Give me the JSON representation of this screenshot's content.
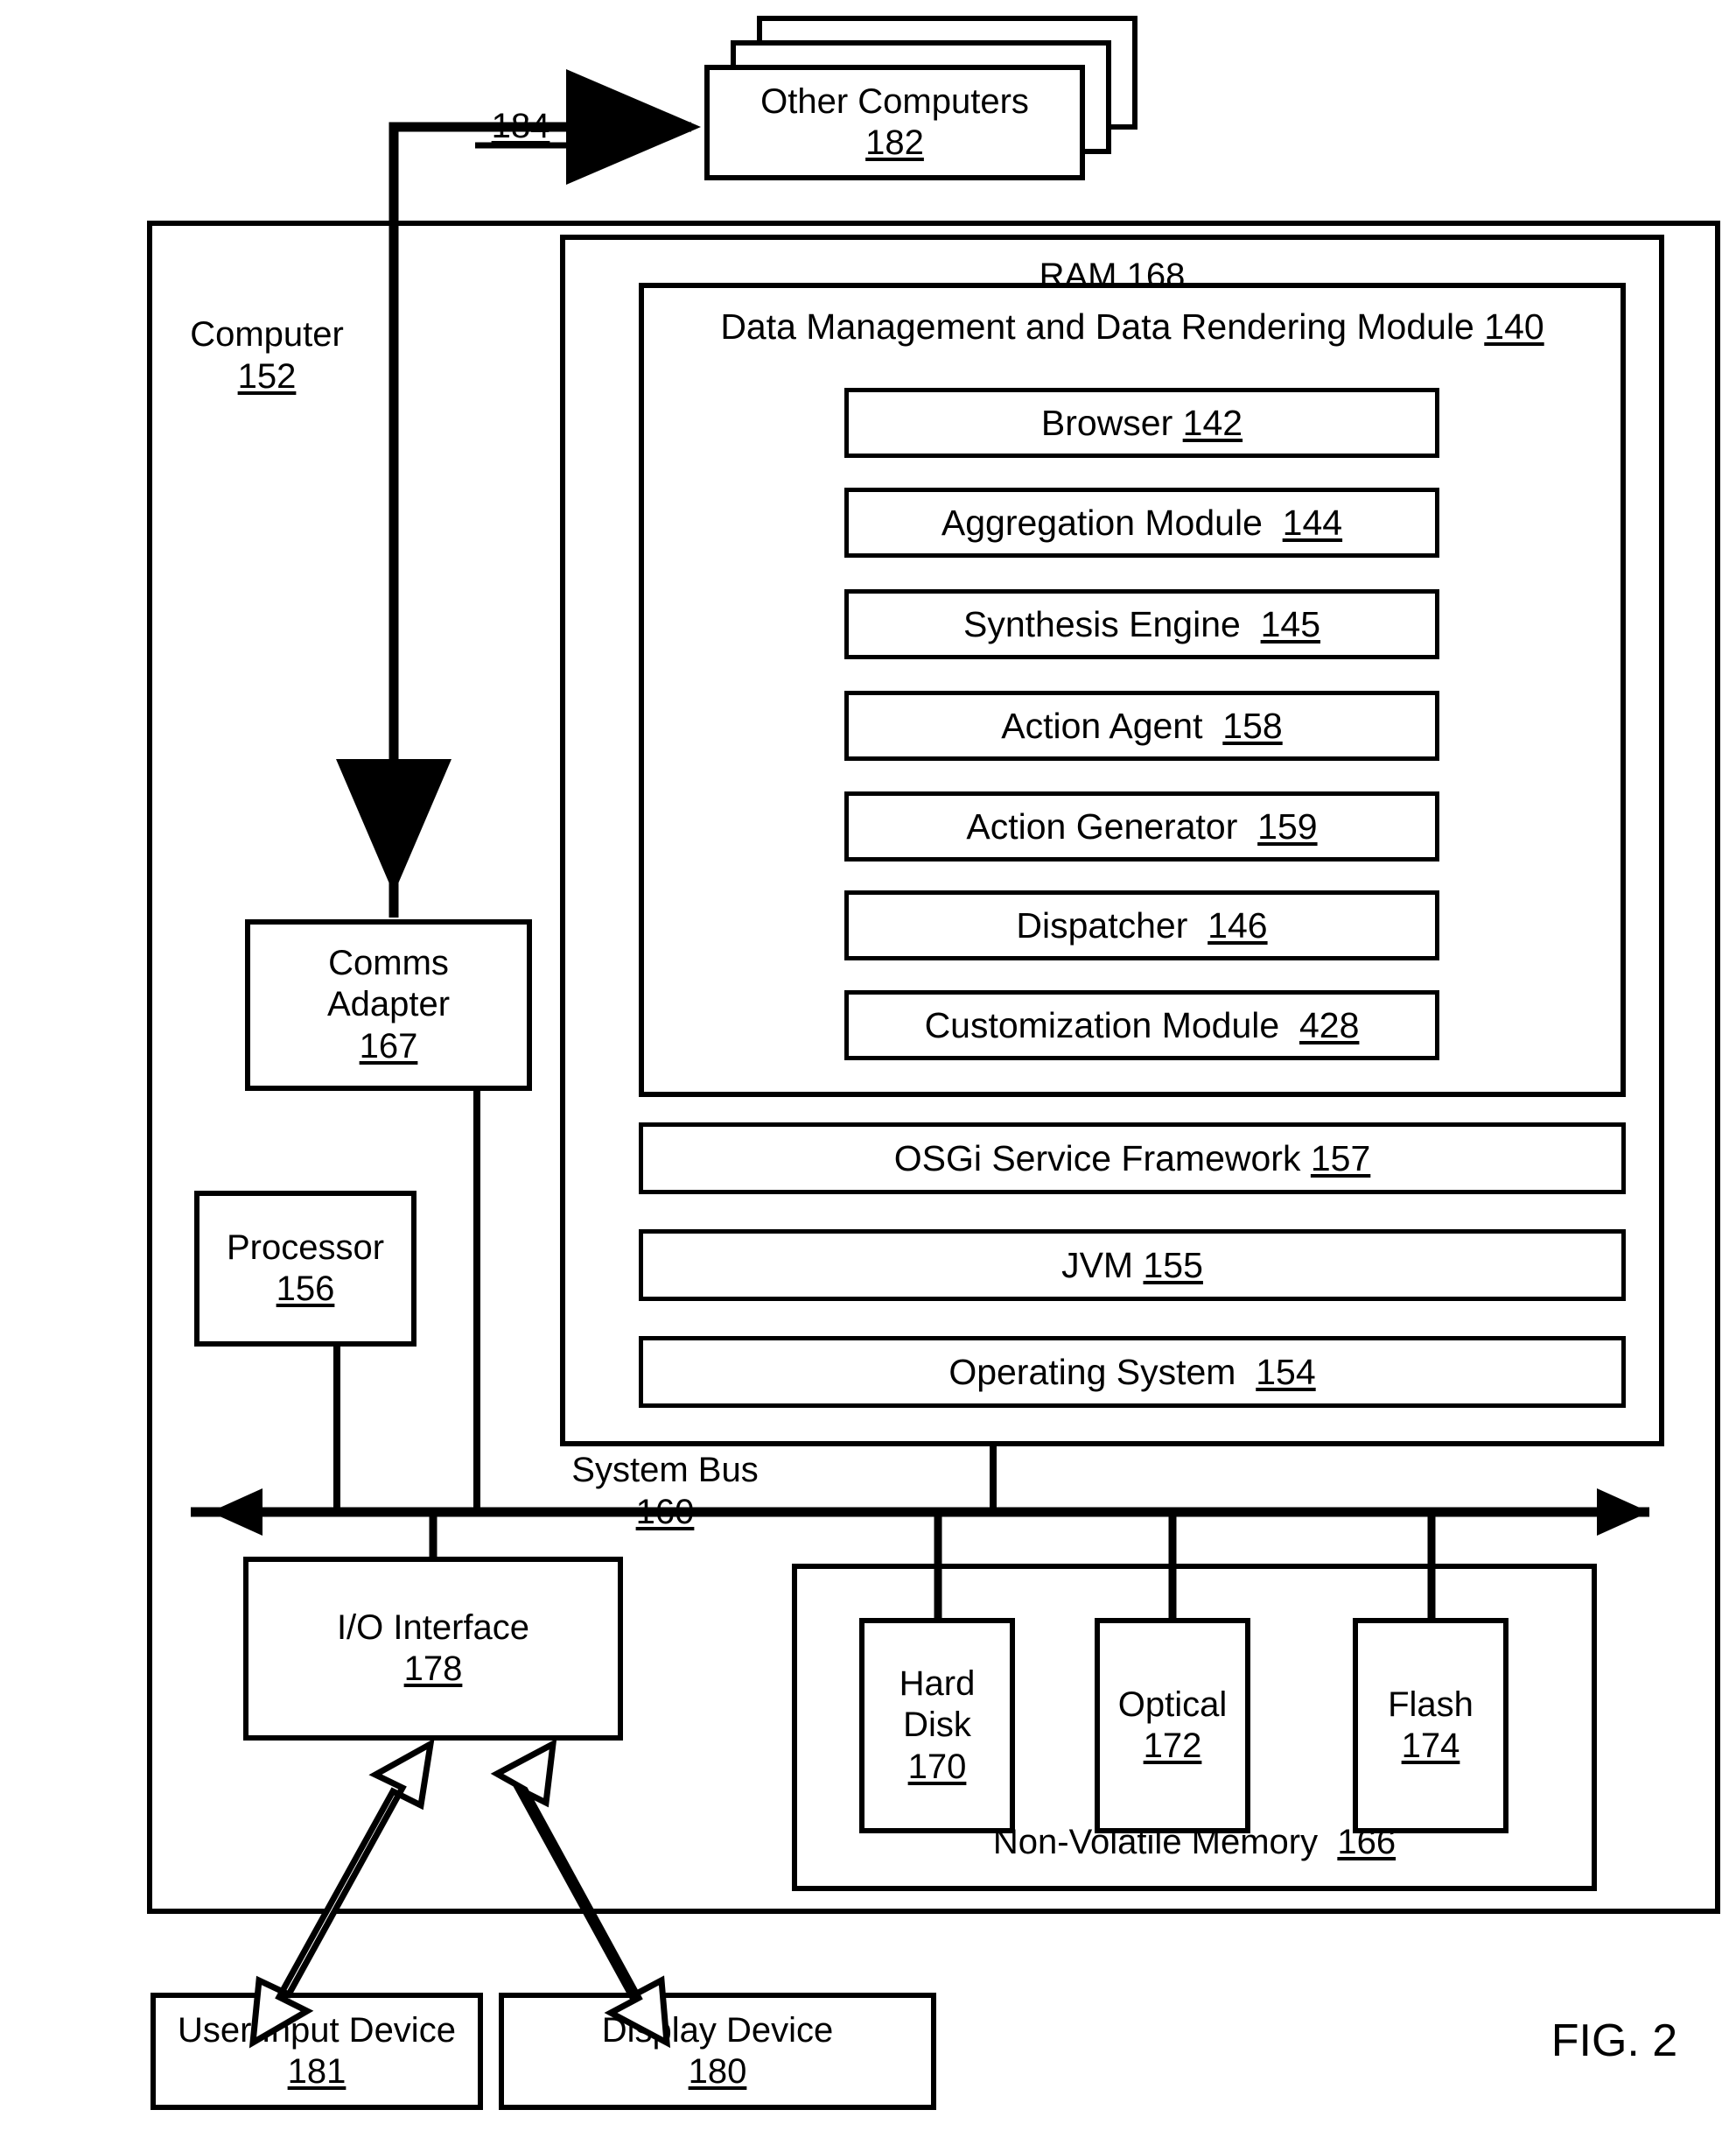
{
  "figure": {
    "caption": "FIG. 2"
  },
  "other_computers": {
    "label": "Other Computers",
    "number": "182",
    "stack_count": 3
  },
  "network_link": {
    "number": "184"
  },
  "computer": {
    "label": "Computer",
    "number": "152"
  },
  "comms_adapter": {
    "line1": "Comms",
    "line2": "Adapter",
    "number": "167"
  },
  "processor": {
    "label": "Processor",
    "number": "156"
  },
  "ram": {
    "label": "RAM",
    "number": "168"
  },
  "dmdr_module": {
    "label": "Data Management and Data Rendering Module",
    "number": "140",
    "items": [
      {
        "label": "Browser",
        "number": "142"
      },
      {
        "label": "Aggregation Module",
        "number": "144"
      },
      {
        "label": "Synthesis Engine",
        "number": "145"
      },
      {
        "label": "Action Agent",
        "number": "158"
      },
      {
        "label": "Action Generator",
        "number": "159"
      },
      {
        "label": "Dispatcher",
        "number": "146"
      },
      {
        "label": "Customization Module",
        "number": "428"
      }
    ]
  },
  "ram_layers": [
    {
      "label": "OSGi Service Framework",
      "number": "157"
    },
    {
      "label": "JVM",
      "number": "155"
    },
    {
      "label": "Operating System",
      "number": "154"
    }
  ],
  "system_bus": {
    "label": "System Bus",
    "number": "160"
  },
  "io_interface": {
    "label": "I/O Interface",
    "number": "178"
  },
  "non_volatile_memory": {
    "label": "Non-Volatile Memory",
    "number": "166",
    "drives": [
      {
        "line1": "Hard",
        "line2": "Disk",
        "number": "170"
      },
      {
        "line1": "Optical",
        "line2": "",
        "number": "172"
      },
      {
        "line1": "Flash",
        "line2": "",
        "number": "174"
      }
    ]
  },
  "peripherals": [
    {
      "label": "User Input Device",
      "number": "181"
    },
    {
      "label": "Display Device",
      "number": "180"
    }
  ],
  "colors": {
    "ink": "#000000",
    "paper": "#ffffff"
  }
}
